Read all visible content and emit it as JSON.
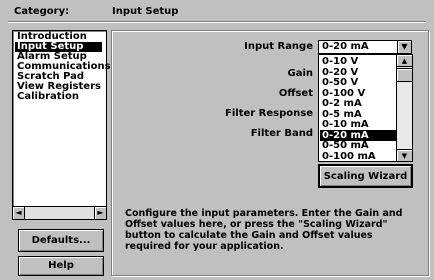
{
  "header": {
    "category_label": "Category:",
    "section_title": "Input Setup"
  },
  "sidebar": {
    "items": [
      {
        "label": "Introduction",
        "selected": false
      },
      {
        "label": "Input Setup",
        "selected": true
      },
      {
        "label": "Alarm Setup",
        "selected": false
      },
      {
        "label": "Communications",
        "selected": false
      },
      {
        "label": "Scratch Pad",
        "selected": false
      },
      {
        "label": "View Registers",
        "selected": false
      },
      {
        "label": "Calibration",
        "selected": false
      }
    ],
    "scroll_left_icon": "◄",
    "scroll_right_icon": "►"
  },
  "buttons": {
    "defaults": "Defaults...",
    "help": "Help",
    "scaling_wizard": "Scaling Wizard"
  },
  "form": {
    "input_range_label": "Input Range",
    "gain_label": "Gain",
    "offset_label": "Offset",
    "filter_response_label": "Filter Response",
    "filter_band_label": "Filter Band",
    "input_range_value": "0-20 mA",
    "dropdown_arrow": "▼"
  },
  "dropdown": {
    "options": [
      "0-10 V",
      "0-20 V",
      "0-50 V",
      "0-100 V",
      "0-2 mA",
      "0-5 mA",
      "0-10 mA",
      "0-20 mA",
      "0-50 mA",
      "0-100 mA"
    ],
    "selected": "0-20 mA",
    "scroll_up_icon": "▲",
    "scroll_down_icon": "▼"
  },
  "description": "Configure the input parameters.  Enter the Gain and Offset values here, or press the \"Scaling Wizard\" button to calculate the Gain and Offset values required for your application."
}
